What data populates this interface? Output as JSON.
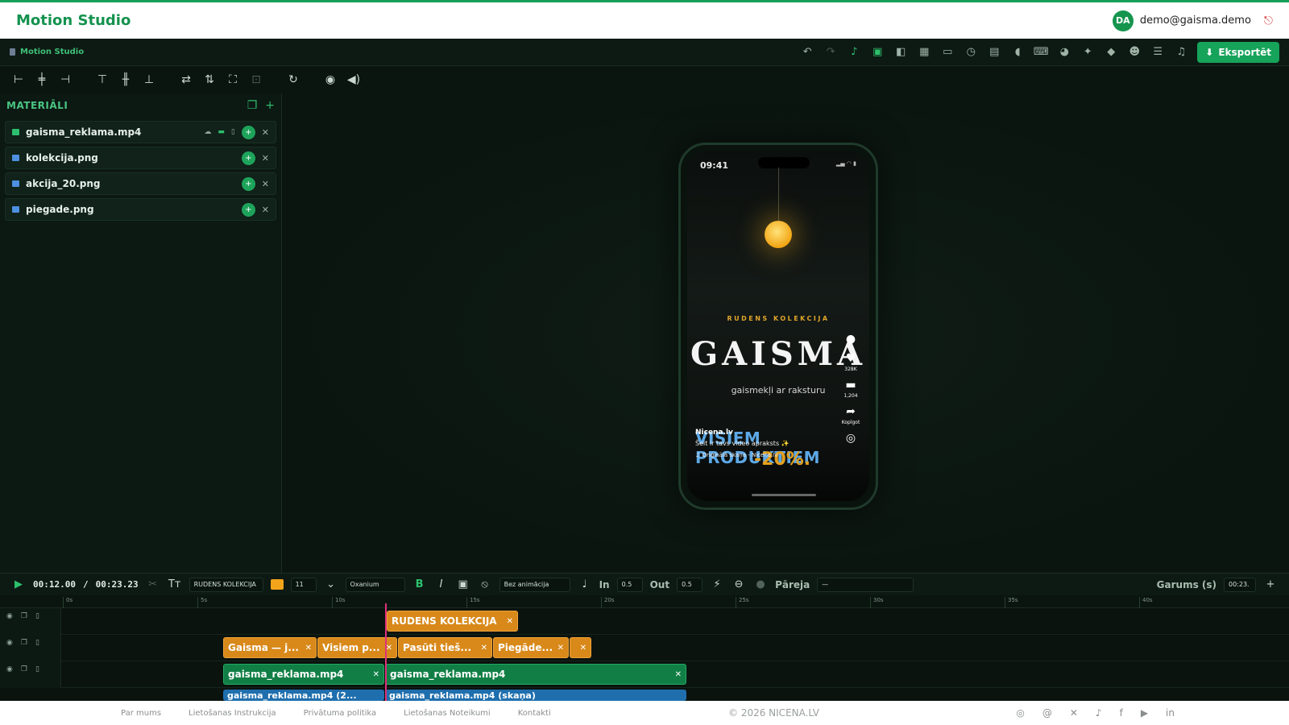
{
  "site": {
    "brand": "Motion Studio",
    "user": {
      "initials": "DA",
      "email": "demo@gaisma.demo"
    }
  },
  "appbar": {
    "name": "Motion Studio",
    "export_label": "Eksportēt",
    "icons": [
      "undo-icon",
      "redo-icon",
      "tiktok-icon",
      "safe-area-icon",
      "mirror-icon",
      "grid-icon",
      "folder-icon",
      "history-icon",
      "file-icon",
      "volume-icon",
      "keyboard-icon",
      "palette-icon",
      "sparkles-icon",
      "layers-icon",
      "robot-icon",
      "notes-icon",
      "bell-icon"
    ]
  },
  "materials": {
    "title": "MATERIĀLI",
    "items": [
      {
        "name": "gaisma_reklama.mp4",
        "type": "video",
        "color": "#2dbf6e"
      },
      {
        "name": "kolekcija.png",
        "type": "image",
        "color": "#4d8fe0"
      },
      {
        "name": "akcija_20.png",
        "type": "image",
        "color": "#4d8fe0"
      },
      {
        "name": "piegade.png",
        "type": "image",
        "color": "#4d8fe0"
      }
    ]
  },
  "preview": {
    "time": "09:41",
    "kicker": "RUDENS KOLEKCIJA",
    "title": "GAISMA",
    "subtitle": "gaismekļi ar raksturu",
    "promo": "VISIEM PRODUKTIEM",
    "percent": "-20%.",
    "caption_user": "Nicena.lv",
    "caption_text": "Šeit ir tavs video apraksts ✨",
    "caption_sound": "♫ Oriģinālā skaņa - Nicena.lv",
    "likes": "328K",
    "comments": "1,204",
    "share": "Kopīgot"
  },
  "timeline": {
    "current": "00:12.00",
    "total": "00:23.23",
    "text_value": "RUDENS KOLEKCIJA",
    "size": "11",
    "font": "Oxanium",
    "animation": "Bez animācija",
    "in_label": "In",
    "in_value": "0.5",
    "out_label": "Out",
    "out_value": "0.5",
    "transition_label": "Pāreja",
    "transition_value": "—",
    "duration_label": "Garums (s)",
    "duration_value": "00:23.",
    "ruler": [
      "0s",
      "5s",
      "10s",
      "15s",
      "20s",
      "25s",
      "30s",
      "35s",
      "40s"
    ],
    "track1": [
      {
        "label": "RUDENS KOLEKCIJA"
      }
    ],
    "track2": [
      {
        "label": "Gaisma — j..."
      },
      {
        "label": "Visiem p..."
      },
      {
        "label": "Pasūti tieš..."
      },
      {
        "label": "Piegāde..."
      },
      {
        "label": ""
      }
    ],
    "track3": [
      {
        "label": "gaisma_reklama.mp4"
      },
      {
        "label": "gaisma_reklama.mp4"
      }
    ],
    "track4": [
      {
        "label": "gaisma_reklama.mp4 (2..."
      },
      {
        "label": "gaisma_reklama.mp4 (skaņa)"
      }
    ]
  },
  "footer": {
    "links": [
      "Par mums",
      "Lietošanas Instrukcija",
      "Privātuma politika",
      "Lietošanas Noteikumi",
      "Kontakti"
    ],
    "copyright": "© 2026 NICENA.LV",
    "social": [
      "instagram-icon",
      "threads-icon",
      "x-icon",
      "tiktok-icon",
      "facebook-icon",
      "youtube-icon",
      "linkedin-icon"
    ]
  }
}
